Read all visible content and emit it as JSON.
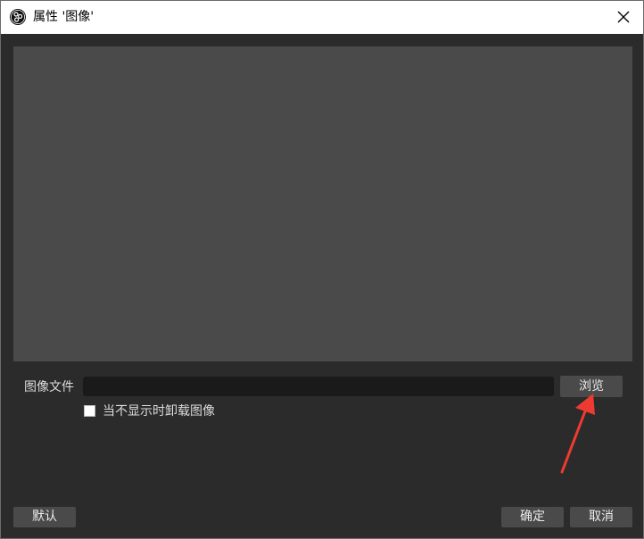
{
  "window": {
    "title": "属性 '图像'",
    "icon": "obs-logo-icon",
    "close_icon": "close-icon"
  },
  "image_file": {
    "label": "图像文件",
    "value": "",
    "browse_label": "浏览"
  },
  "options": {
    "unload_when_hidden_label": "当不显示时卸载图像",
    "unload_when_hidden_checked": false
  },
  "footer": {
    "default_label": "默认",
    "ok_label": "确定",
    "cancel_label": "取消"
  },
  "colors": {
    "background": "#2b2b2b",
    "preview": "#4a4a4a",
    "annotation_arrow": "#ee3b32"
  }
}
